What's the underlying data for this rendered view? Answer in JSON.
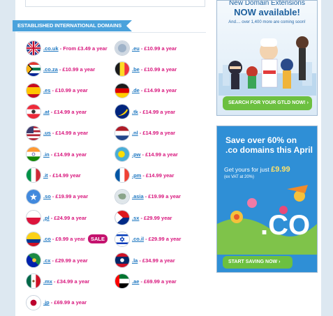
{
  "section_title": "ESTABLISHED INTERNATIONAL DOMAINS",
  "domains": [
    {
      "tld": ".co.uk",
      "price": "- From £3.49 a year",
      "flag": "uk-flag-icon"
    },
    {
      "tld": ".eu",
      "price": "- £10.99 a year",
      "flag": "eu-flag-icon"
    },
    {
      "tld": ".co.za",
      "price": "- £10.99 a year",
      "flag": "south-africa-flag-icon"
    },
    {
      "tld": ".be",
      "price": "- £10.99 a year",
      "flag": "belgium-flag-icon"
    },
    {
      "tld": ".es",
      "price": "- £10.99 a year",
      "flag": "spain-flag-icon"
    },
    {
      "tld": ".de",
      "price": "- £14.99 a year",
      "flag": "germany-flag-icon"
    },
    {
      "tld": ".at",
      "price": "- £14.99 a year",
      "flag": "austria-flag-icon"
    },
    {
      "tld": ".tk",
      "price": "- £14.99 a year",
      "flag": "tokelau-flag-icon"
    },
    {
      "tld": ".us",
      "price": "- £14.99 a year",
      "flag": "usa-flag-icon"
    },
    {
      "tld": ".nl",
      "price": "- £14.99 a year",
      "flag": "netherlands-flag-icon"
    },
    {
      "tld": ".in",
      "price": "- £14.99 a year",
      "flag": "india-flag-icon"
    },
    {
      "tld": ".pw",
      "price": "- £14.99 a year",
      "flag": "palau-flag-icon"
    },
    {
      "tld": ".it",
      "price": "- £14.99 year",
      "flag": "italy-flag-icon"
    },
    {
      "tld": ".pm",
      "price": "- £14.99 year",
      "flag": "france-flag-icon"
    },
    {
      "tld": ".so",
      "price": "- £19.99 a year",
      "flag": "somalia-flag-icon"
    },
    {
      "tld": ".asia",
      "price": "- £19.99 a year",
      "flag": "asia-map-icon"
    },
    {
      "tld": ".pl",
      "price": "- £24.99 a year",
      "flag": "poland-flag-icon"
    },
    {
      "tld": ".sx",
      "price": "- £29.99 year",
      "flag": "sint-maarten-flag-icon"
    },
    {
      "tld": ".co",
      "price": "- £9.99 a year",
      "flag": "colombia-flag-icon",
      "badge": "SALE"
    },
    {
      "tld": ".co.il",
      "price": "- £29.99 a year",
      "flag": "israel-flag-icon"
    },
    {
      "tld": ".cx",
      "price": "- £29.99 a year",
      "flag": "christmas-island-flag-icon"
    },
    {
      "tld": ".la",
      "price": "- £34.99 a year",
      "flag": "laos-flag-icon"
    },
    {
      "tld": ".mx",
      "price": "- £34.99 a year",
      "flag": "mexico-flag-icon"
    },
    {
      "tld": ".ae",
      "price": "- £69.99 a year",
      "flag": "uae-flag-icon"
    },
    {
      "tld": ".jp",
      "price": "- £69.99 a year",
      "flag": "japan-flag-icon"
    }
  ],
  "ad_gtld": {
    "line1": "New Domain Extensions",
    "line2": "NOW available!",
    "line3": "And.... over 1,400 more are coming soon!",
    "button": "SEARCH FOR YOUR GTLD NOW!"
  },
  "ad_co": {
    "headline1": "Save over 60% on",
    "headline2": ".co domains this April",
    "offer_prefix": "Get yours for just",
    "offer_price": "£9.99",
    "offer_note": "(ex VAT at 20%)",
    "logo_text": ".CO",
    "button": "START SAVING NOW"
  },
  "colors": {
    "link": "#2079c2",
    "price": "#d8167d",
    "ribbon": "#4aa2dc",
    "cta": "#6cc040"
  }
}
